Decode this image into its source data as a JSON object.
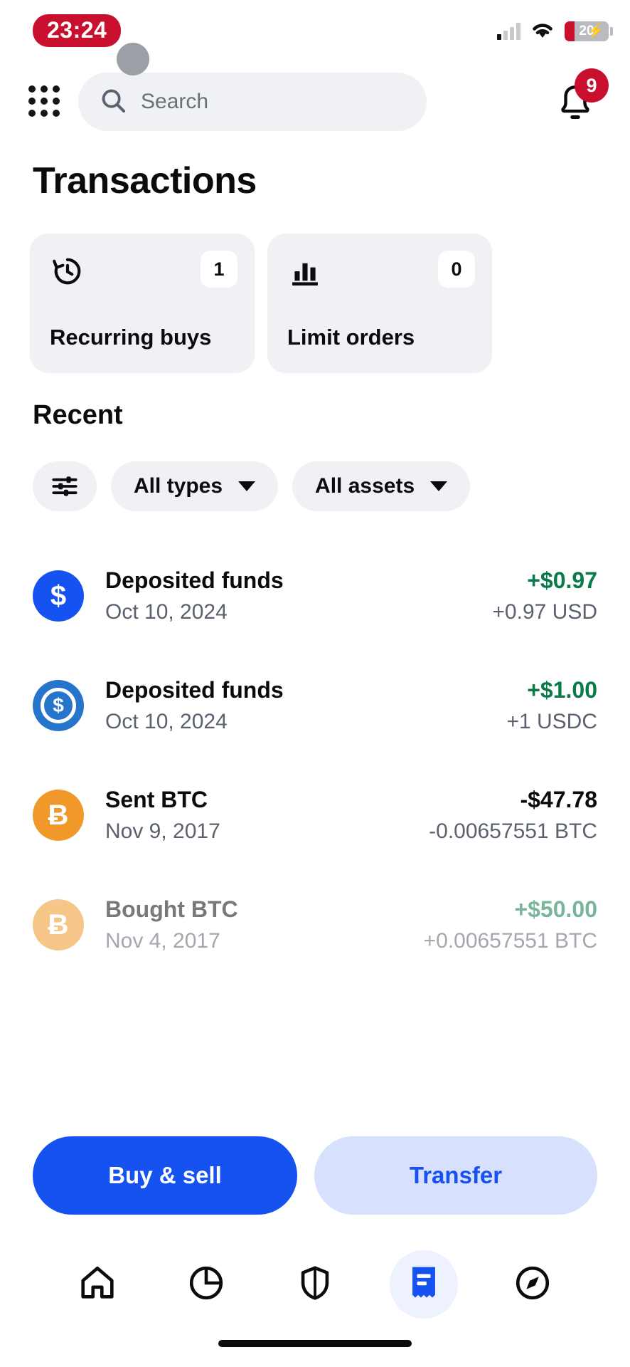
{
  "status_bar": {
    "time": "23:24",
    "battery_level": "20",
    "battery_charging": true,
    "signal_icon": "cellular-signal-icon",
    "wifi_icon": "wifi-icon",
    "battery_icon": "battery-icon"
  },
  "header": {
    "menu_icon": "grid-menu-icon",
    "search": {
      "placeholder": "Search",
      "value": "",
      "icon": "search-icon"
    },
    "notifications": {
      "icon": "bell-icon",
      "badge": "9"
    }
  },
  "page": {
    "title": "Transactions"
  },
  "summary_cards": [
    {
      "label": "Recurring buys",
      "count": "1",
      "icon": "history-clock-icon"
    },
    {
      "label": "Limit orders",
      "count": "0",
      "icon": "bar-chart-icon"
    }
  ],
  "recent": {
    "heading": "Recent",
    "filters": {
      "settings_icon": "sliders-filter-icon",
      "chips": [
        {
          "label": "All types",
          "icon": "chevron-down-icon"
        },
        {
          "label": "All assets",
          "icon": "chevron-down-icon"
        }
      ]
    }
  },
  "transactions": [
    {
      "title": "Deposited funds",
      "date": "Oct 10, 2024",
      "amount": "+$0.97",
      "sub_amount": "+0.97 USD",
      "amount_sign": "positive",
      "asset_icon": "usd-dollar-icon",
      "asset_symbol": "$",
      "icon_color": "#1652f0",
      "faded": false
    },
    {
      "title": "Deposited funds",
      "date": "Oct 10, 2024",
      "amount": "+$1.00",
      "sub_amount": "+1 USDC",
      "amount_sign": "positive",
      "asset_icon": "usdc-coin-icon",
      "asset_symbol": "$",
      "icon_color": "#2775ca",
      "faded": false
    },
    {
      "title": "Sent BTC",
      "date": "Nov 9, 2017",
      "amount": "-$47.78",
      "sub_amount": "-0.00657551 BTC",
      "amount_sign": "negative",
      "asset_icon": "bitcoin-icon",
      "asset_symbol": "Ƀ",
      "icon_color": "#f0982a",
      "faded": false
    },
    {
      "title": "Bought BTC",
      "date": "Nov 4, 2017",
      "amount": "+$50.00",
      "sub_amount": "+0.00657551 BTC",
      "amount_sign": "positive",
      "asset_icon": "bitcoin-icon",
      "asset_symbol": "Ƀ",
      "icon_color": "#f0982a",
      "faded": true
    }
  ],
  "actions": {
    "primary": "Buy & sell",
    "secondary": "Transfer",
    "primary_color": "#1652f0",
    "secondary_color": "#d7e0fd"
  },
  "bottom_nav": {
    "items": [
      {
        "name": "home",
        "icon": "home-icon",
        "active": false
      },
      {
        "name": "portfolio",
        "icon": "pie-chart-icon",
        "active": false
      },
      {
        "name": "security",
        "icon": "shield-icon",
        "active": false
      },
      {
        "name": "transactions",
        "icon": "receipt-icon",
        "active": true
      },
      {
        "name": "explore",
        "icon": "compass-icon",
        "active": false
      }
    ],
    "active_color": "#1652f0"
  }
}
